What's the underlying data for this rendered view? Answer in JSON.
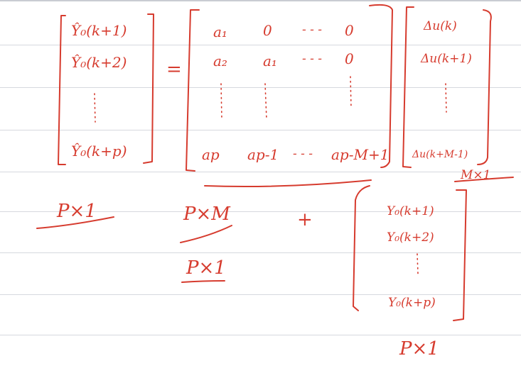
{
  "note": {
    "left_vector": [
      "Ŷ₀(k+1)",
      "Ŷ₀(k+2)",
      "Ŷ₀(k+p)"
    ],
    "left_dim": "P×1",
    "equals": "=",
    "matrix": {
      "row1": [
        "a₁",
        "0",
        "- - -",
        "0"
      ],
      "row2": [
        "a₂",
        "a₁",
        "- - -",
        "0"
      ],
      "row_last": [
        "ap",
        "ap-1",
        "- - -",
        "ap-M+1"
      ]
    },
    "matrix_dim": "P×M",
    "product_dim": "P×1",
    "delta_vector": [
      "Δu(k)",
      "Δu(k+1)",
      "Δu(k+M-1)"
    ],
    "delta_dim": "M×1",
    "plus": "+",
    "y0_vector": [
      "Y₀(k+1)",
      "Y₀(k+2)",
      "Y₀(k+p)"
    ],
    "y0_dim": "P×1"
  }
}
